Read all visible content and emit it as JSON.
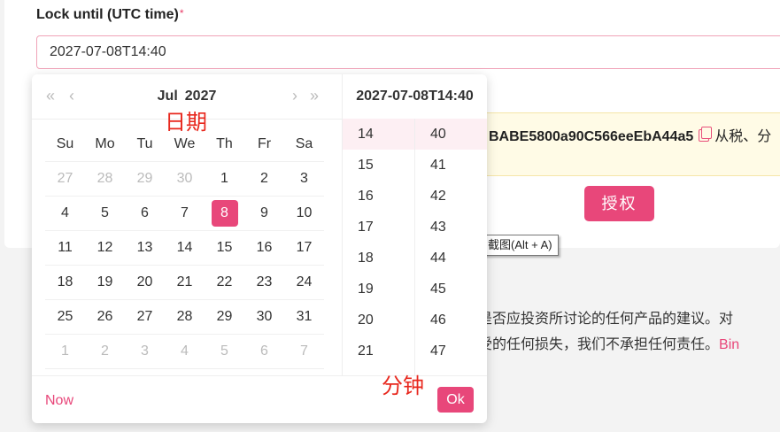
{
  "form": {
    "label": "Lock until (UTC time)",
    "required_mark": "*",
    "value": "2027-07-08T14:40"
  },
  "notice": {
    "address": "BABE5800a90C566eeEbA44a5",
    "text": "从税、分"
  },
  "authorize_button": "授权",
  "disclaimer": {
    "line1": "是否应投资所讨论的任何产品的建议。对",
    "line2": "受的任何损失，我们不承担任何责任。",
    "link": "Bin"
  },
  "tooltip": "截图(Alt + A)",
  "picker": {
    "nav": {
      "prev_year": "«",
      "prev_month": "‹",
      "next_month": "›",
      "next_year": "»"
    },
    "month": "Jul",
    "year": "2027",
    "selected_datetime": "2027-07-08T14:40",
    "weekdays": [
      "Su",
      "Mo",
      "Tu",
      "We",
      "Th",
      "Fr",
      "Sa"
    ],
    "weeks": [
      [
        {
          "d": "27",
          "m": true
        },
        {
          "d": "28",
          "m": true
        },
        {
          "d": "29",
          "m": true
        },
        {
          "d": "30",
          "m": true
        },
        {
          "d": "1"
        },
        {
          "d": "2"
        },
        {
          "d": "3"
        }
      ],
      [
        {
          "d": "4"
        },
        {
          "d": "5"
        },
        {
          "d": "6"
        },
        {
          "d": "7"
        },
        {
          "d": "8",
          "s": true
        },
        {
          "d": "9"
        },
        {
          "d": "10"
        }
      ],
      [
        {
          "d": "11"
        },
        {
          "d": "12"
        },
        {
          "d": "13"
        },
        {
          "d": "14"
        },
        {
          "d": "15"
        },
        {
          "d": "16"
        },
        {
          "d": "17"
        }
      ],
      [
        {
          "d": "18"
        },
        {
          "d": "19"
        },
        {
          "d": "20"
        },
        {
          "d": "21"
        },
        {
          "d": "22"
        },
        {
          "d": "23"
        },
        {
          "d": "24"
        }
      ],
      [
        {
          "d": "25"
        },
        {
          "d": "26"
        },
        {
          "d": "27"
        },
        {
          "d": "28"
        },
        {
          "d": "29"
        },
        {
          "d": "30"
        },
        {
          "d": "31"
        }
      ],
      [
        {
          "d": "1",
          "m": true
        },
        {
          "d": "2",
          "m": true
        },
        {
          "d": "3",
          "m": true
        },
        {
          "d": "4",
          "m": true
        },
        {
          "d": "5",
          "m": true
        },
        {
          "d": "6",
          "m": true
        },
        {
          "d": "7",
          "m": true
        }
      ]
    ],
    "hours": [
      "14",
      "15",
      "16",
      "17",
      "18",
      "19",
      "20",
      "21"
    ],
    "minutes": [
      "40",
      "41",
      "42",
      "43",
      "44",
      "45",
      "46",
      "47"
    ],
    "selected_hour": "14",
    "selected_minute": "40",
    "now_label": "Now",
    "ok_label": "Ok"
  },
  "annotations": {
    "date": "日期",
    "minute": "分钟",
    "color": "#e8281e"
  },
  "colors": {
    "accent": "#e8477a"
  }
}
